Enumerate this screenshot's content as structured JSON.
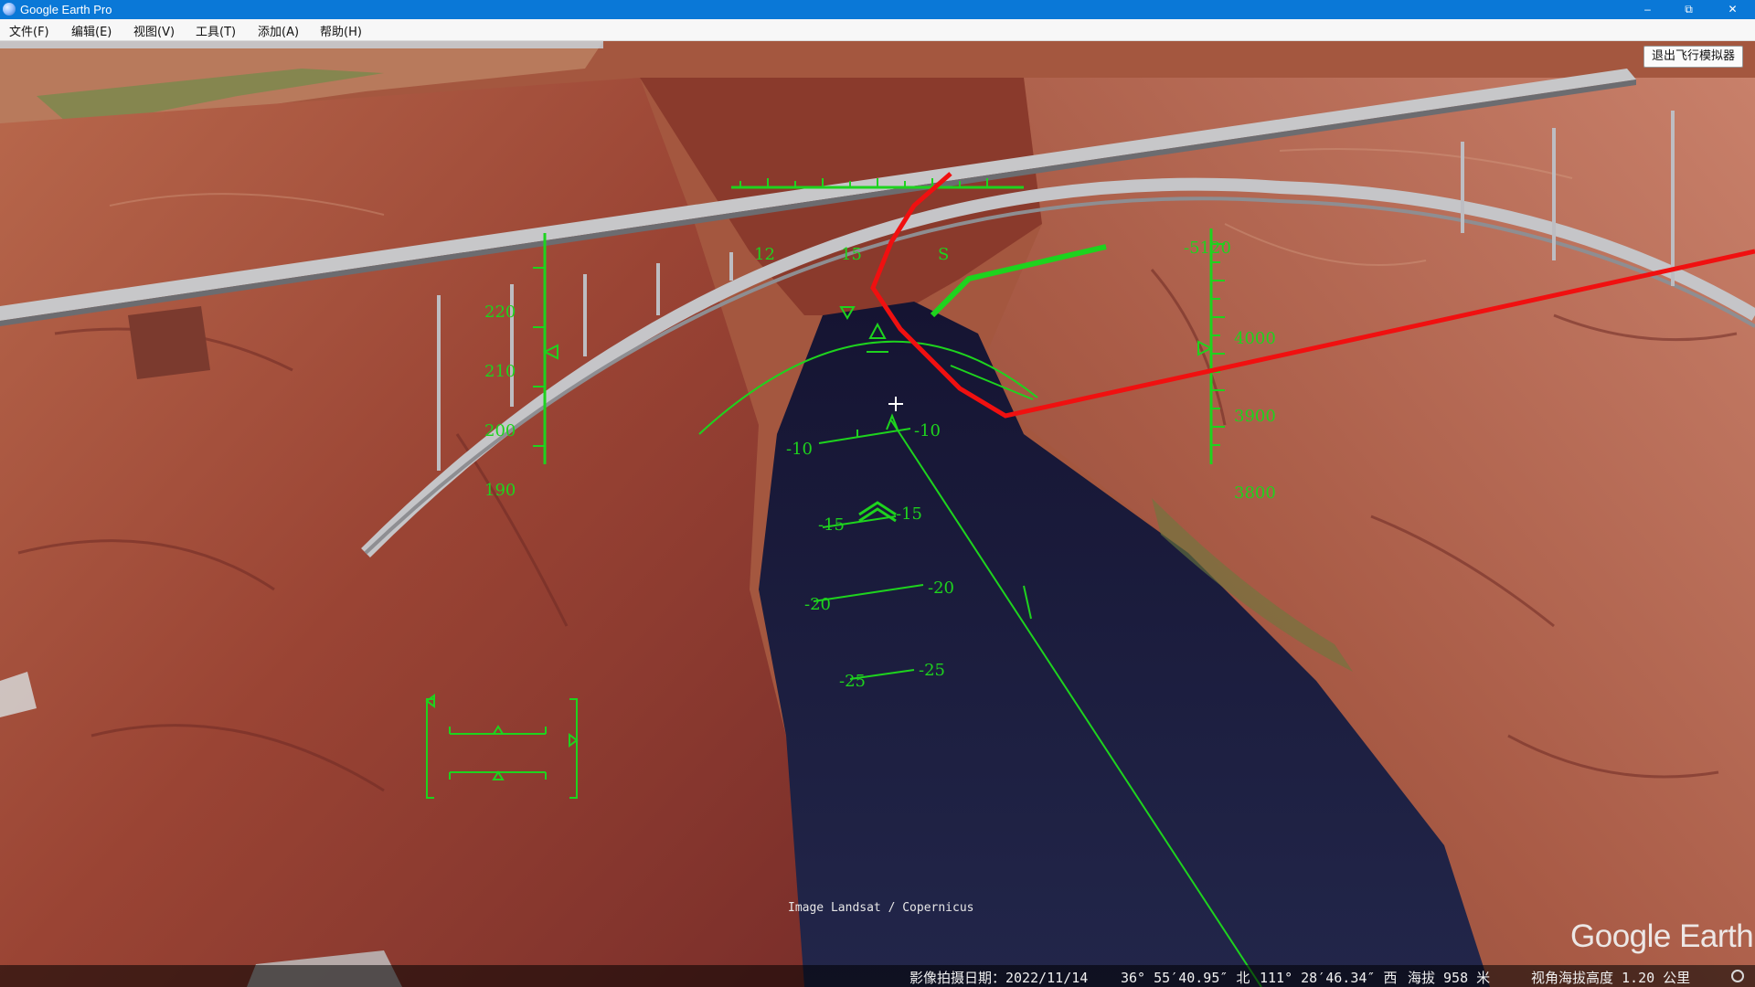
{
  "window": {
    "title": "Google Earth Pro",
    "app_icon": "google-earth-icon",
    "controls": {
      "minimize": "–",
      "restore": "⧉",
      "close": "✕"
    }
  },
  "menu": [
    {
      "label": "文件(F)"
    },
    {
      "label": "编辑(E)"
    },
    {
      "label": "视图(V)"
    },
    {
      "label": "工具(T)"
    },
    {
      "label": "添加(A)"
    },
    {
      "label": "帮助(H)"
    }
  ],
  "viewport": {
    "exit_flight_sim_label": "退出飞行模拟器",
    "attribution": "Image Landsat / Copernicus",
    "logo_text": "Google Earth"
  },
  "hud": {
    "color": "#1ed31e",
    "heading_ticks": [
      "12",
      "15",
      "S"
    ],
    "speed_ticks": [
      "220",
      "210",
      "200",
      "190"
    ],
    "altitude_ticks": [
      "4000",
      "3900",
      "3800"
    ],
    "vertical_speed": "-5120",
    "pitch_ladder": [
      {
        "left": "-10",
        "right": "-10"
      },
      {
        "left": "-15",
        "right": "-15"
      },
      {
        "left": "-20",
        "right": "-20"
      },
      {
        "left": "-25",
        "right": "-25"
      }
    ]
  },
  "status_bar": {
    "imagery_date": "影像拍摄日期：2022/11/14",
    "latitude": "36° 55′40.95″ 北",
    "longitude": "111° 28′46.34″ 西",
    "elevation": "海拔   958 米",
    "eye_altitude": "视角海拔高度   1.20 公里",
    "globe_icon": "globe-status-icon"
  },
  "colors": {
    "titlebar": "#0a78d7",
    "hud_green": "#1ed31e",
    "path_red": "#f01010",
    "water": "#1b1d3a",
    "rock": "#a0523d"
  }
}
